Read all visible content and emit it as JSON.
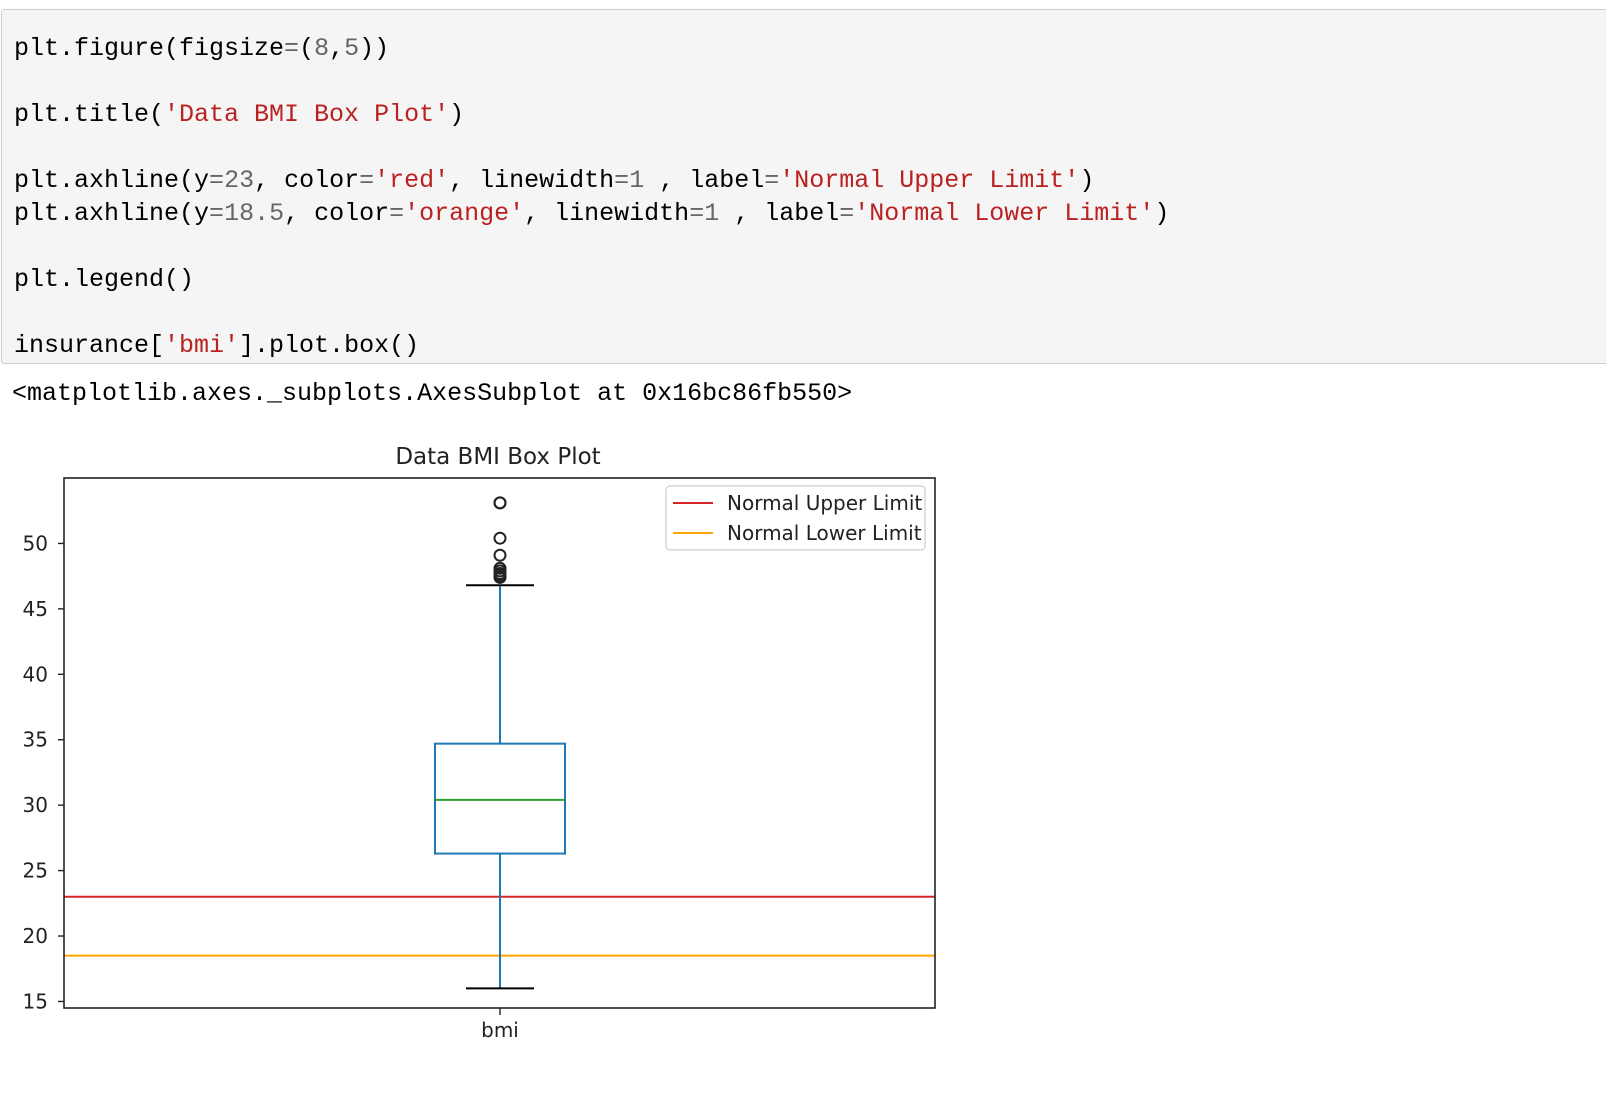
{
  "code": {
    "line1": {
      "a": "plt.figure(figsize",
      "eq": "=",
      "b": "(",
      "n1": "8",
      "c": ",",
      "n2": "5",
      "d": "))"
    },
    "line2": {
      "a": "plt.title(",
      "s": "'Data BMI Box Plot'",
      "b": ")"
    },
    "line3": {
      "a": "plt.axhline(y",
      "eq1": "=",
      "n1": "23",
      "b": ", color",
      "eq2": "=",
      "s1": "'red'",
      "c": ", linewidth",
      "eq3": "=",
      "n2": "1",
      "d": " , label",
      "eq4": "=",
      "s2": "'Normal Upper Limit'",
      "e": ")"
    },
    "line4": {
      "a": "plt.axhline(y",
      "eq1": "=",
      "n1": "18.5",
      "b": ", color",
      "eq2": "=",
      "s1": "'orange'",
      "c": ", linewidth",
      "eq3": "=",
      "n2": "1",
      "d": " , label",
      "eq4": "=",
      "s2": "'Normal Lower Limit'",
      "e": ")"
    },
    "line5": "plt.legend()",
    "line6": {
      "a": "insurance[",
      "s": "'bmi'",
      "b": "].plot.box()"
    }
  },
  "output_repr": "<matplotlib.axes._subplots.AxesSubplot at 0x16bc86fb550>",
  "chart_data": {
    "type": "box",
    "title": "Data BMI Box Plot",
    "xlabel": "",
    "ylabel": "",
    "categories": [
      "bmi"
    ],
    "ylim": [
      14.5,
      55.0
    ],
    "yticks": [
      15,
      20,
      25,
      30,
      35,
      40,
      45,
      50
    ],
    "box": {
      "whisker_low": 16.0,
      "q1": 26.3,
      "median": 30.4,
      "q3": 34.7,
      "whisker_high": 46.8,
      "outliers": [
        47.4,
        47.5,
        47.6,
        47.7,
        47.9,
        48.1,
        49.1,
        50.4,
        53.1,
        53.1
      ]
    },
    "hlines": [
      {
        "y": 23,
        "color": "#d62728",
        "label": "Normal Upper Limit"
      },
      {
        "y": 18.5,
        "color": "#ffa500",
        "label": "Normal Lower Limit"
      }
    ],
    "colors": {
      "box": "#1f77b4",
      "median": "#2ca02c",
      "caps": "#000000"
    },
    "legend_position": "upper right",
    "grid": false
  }
}
